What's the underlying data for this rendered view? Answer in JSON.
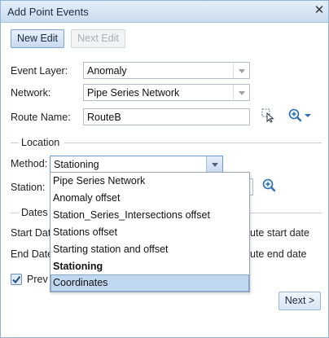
{
  "window": {
    "title": "Add Point Events"
  },
  "toolbar": {
    "new_edit": "New Edit",
    "next_edit": "Next Edit"
  },
  "form": {
    "event_layer_label": "Event Layer:",
    "event_layer_value": "Anomaly",
    "network_label": "Network:",
    "network_value": "Pipe Series Network",
    "route_name_label": "Route Name:",
    "route_name_value": "RouteB"
  },
  "location": {
    "section_label": "Location",
    "method_label": "Method:",
    "method_value": "Stationing",
    "station_label": "Station:",
    "options": [
      "Pipe Series Network",
      "Anomaly offset",
      "Station_Series_Intersections offset",
      "Stations offset",
      "Starting station and offset",
      "Stationing",
      "Coordinates"
    ],
    "selected_option": "Stationing",
    "hovered_option": "Coordinates"
  },
  "dates": {
    "section_label": "Dates",
    "start_label": "Start Date",
    "start_right": "ute start date",
    "end_label": "End Date",
    "end_right": "ute end date",
    "preview_label": "Prev"
  },
  "footer": {
    "next_label": "Next >"
  },
  "icons": {
    "close": "close-icon",
    "select_route": "select-route-cursor-icon",
    "zoom_menu": "zoom-in-icon",
    "station_zoom": "zoom-in-icon",
    "checkbox": "checkmark-icon"
  },
  "colors": {
    "title_bar": "#c9dcf0",
    "accent": "#1f6fbf",
    "hover_item": "#bfd8ef"
  }
}
